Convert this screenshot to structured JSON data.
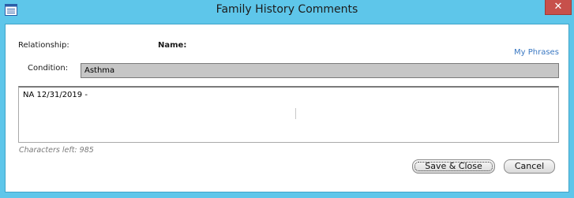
{
  "window": {
    "title": "Family History Comments"
  },
  "icons": {
    "app": "app-window-icon",
    "close": "close-icon"
  },
  "close_button": {
    "glyph": "✕"
  },
  "form": {
    "relationship_label": "Relationship:",
    "name_label": "Name:",
    "condition_label": "Condition:",
    "condition_value": "Asthma",
    "my_phrases_link": "My Phrases",
    "comments_value": "NA 12/31/2019 -",
    "characters_left": "Characters left: 985"
  },
  "buttons": {
    "save_close": "Save & Close",
    "cancel": "Cancel"
  },
  "colors": {
    "frame": "#5ec6ea",
    "close": "#c7504b",
    "link": "#3a78c2",
    "condition_bg": "#c6c6c6"
  }
}
